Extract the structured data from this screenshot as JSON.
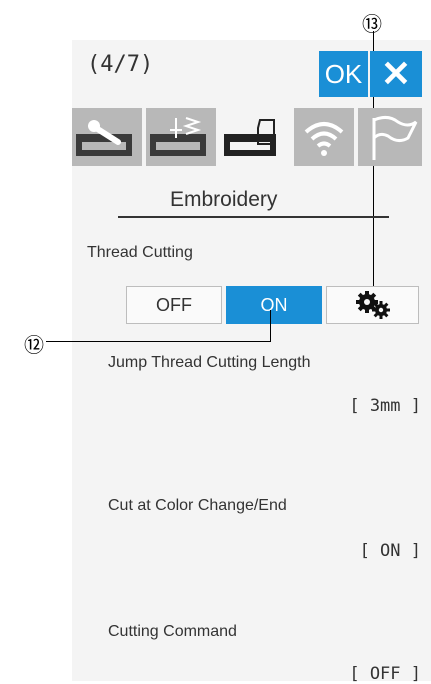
{
  "header": {
    "page_indicator": "(4/7)",
    "ok_label": "OK",
    "close_label": "✕"
  },
  "tabs": [
    {
      "icon": "wrench-machine-icon"
    },
    {
      "icon": "stitch-machine-icon"
    },
    {
      "icon": "embroidery-machine-icon",
      "active": true
    },
    {
      "icon": "wifi-icon"
    },
    {
      "icon": "flag-icon"
    }
  ],
  "section_title": "Embroidery",
  "thread_cutting": {
    "label": "Thread Cutting",
    "off_label": "OFF",
    "on_label": "ON",
    "settings_icon": "gears-icon"
  },
  "settings": [
    {
      "label": "Jump Thread Cutting Length",
      "value": "[ 3mm ]"
    },
    {
      "label": "Cut at Color Change/End",
      "value": "[ ON ]"
    },
    {
      "label": "Cutting Command",
      "value": "[ OFF ]"
    }
  ],
  "callouts": {
    "settings_button": "⑬",
    "on_button": "⑫"
  },
  "colors": {
    "accent": "#1a8fd6",
    "panel": "#f4f4f4",
    "tab_inactive": "#b8b8b8"
  }
}
